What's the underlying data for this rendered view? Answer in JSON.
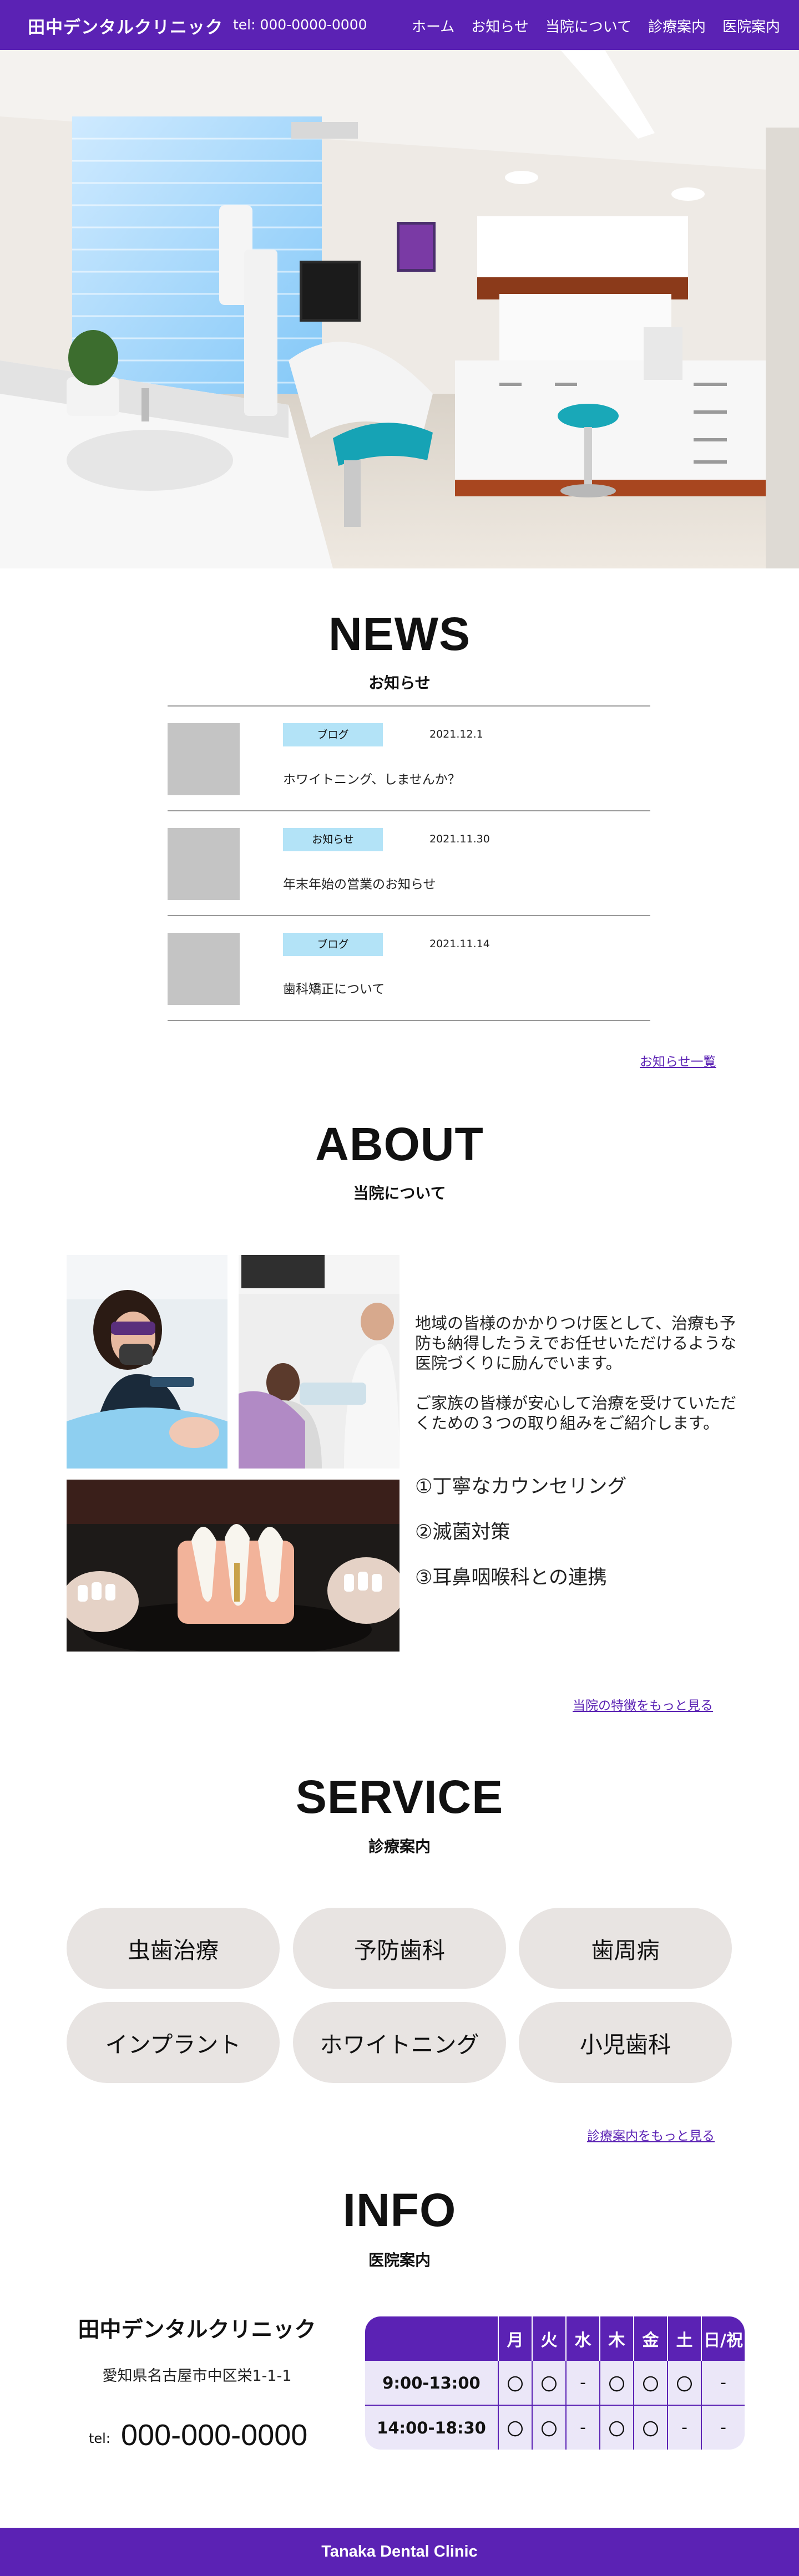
{
  "header": {
    "brand": "田中デンタルクリニック",
    "tel": "tel: 000-0000-0000",
    "nav": [
      "ホーム",
      "お知らせ",
      "当院について",
      "診療案内",
      "医院案内"
    ]
  },
  "news": {
    "title": "NEWS",
    "subtitle": "お知らせ",
    "items": [
      {
        "tag": "ブログ",
        "date": "2021.12.1",
        "title": "ホワイトニング、しませんか？"
      },
      {
        "tag": "お知らせ",
        "date": "2021.11.30",
        "title": "年末年始の営業のお知らせ"
      },
      {
        "tag": "ブログ",
        "date": "2021.11.14",
        "title": "歯科矯正について"
      }
    ],
    "more": "お知らせ一覧"
  },
  "about": {
    "title": "ABOUT",
    "subtitle": "当院について",
    "paragraph1": "地域の皆様のかかりつけ医として、治療も予防も納得したうえでお任せいただけるような医院づくりに励んでいます。",
    "paragraph2": "ご家族の皆様が安心して治療を受けていただくための３つの取り組みをご紹介します。",
    "points": [
      "①丁寧なカウンセリング",
      "②滅菌対策",
      "③耳鼻咽喉科との連携"
    ],
    "more": "当院の特徴をもっと見る"
  },
  "service": {
    "title": "SERVICE",
    "subtitle": "診療案内",
    "items": [
      "虫歯治療",
      "予防歯科",
      "歯周病",
      "インプラント",
      "ホワイトニング",
      "小児歯科"
    ],
    "more": "診療案内をもっと見る"
  },
  "info": {
    "title": "INFO",
    "subtitle": "医院案内",
    "clinic_name": "田中デンタルクリニック",
    "address": "愛知県名古屋市中区栄1-1-1",
    "tel_label": "tel:",
    "tel": "000-000-0000",
    "hours": {
      "days": [
        "月",
        "火",
        "水",
        "木",
        "金",
        "土",
        "日/祝"
      ],
      "rows": [
        {
          "time": "9:00-13:00",
          "cells": [
            "〇",
            "〇",
            "-",
            "〇",
            "〇",
            "〇",
            "-"
          ]
        },
        {
          "time": "14:00-18:30",
          "cells": [
            "〇",
            "〇",
            "-",
            "〇",
            "〇",
            "-",
            "-"
          ]
        }
      ]
    }
  },
  "footer": {
    "text": "Tanaka Dental Clinic"
  },
  "colors": {
    "primary": "#5b22b4",
    "tag_bg": "#b3e3f7",
    "service_bg": "#e8e4e2",
    "hours_bg": "#ebe7f8",
    "thumb": "#c4c4c4"
  }
}
